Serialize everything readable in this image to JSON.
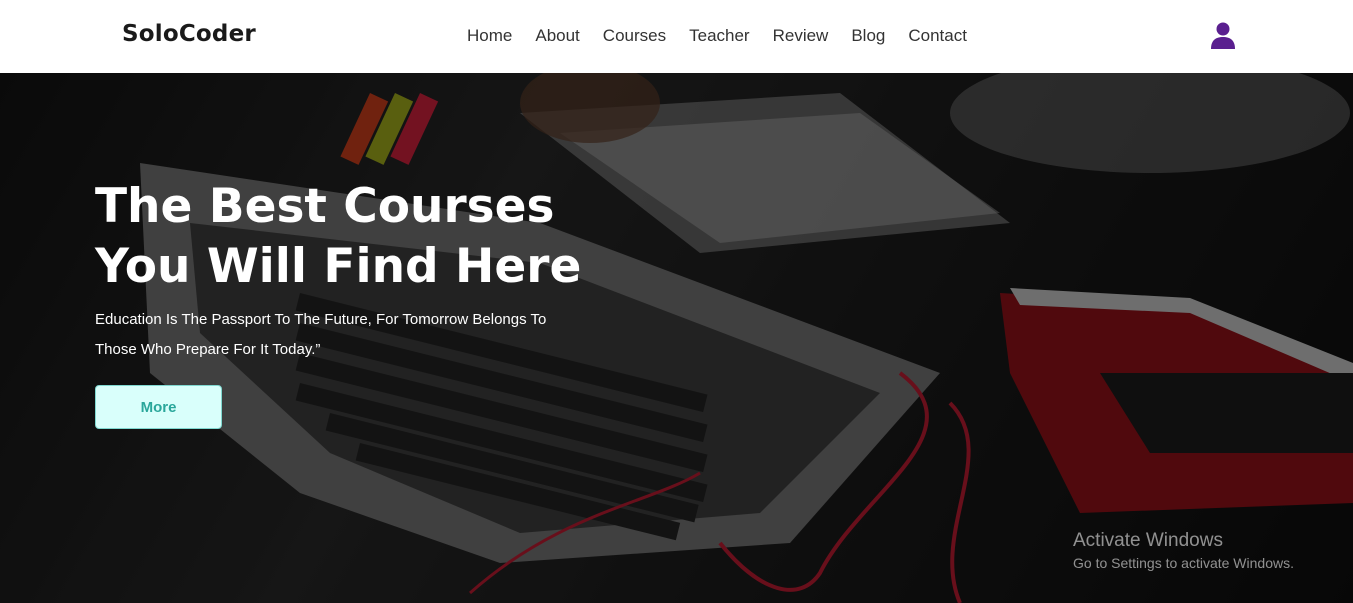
{
  "brand": {
    "logo": "SoloCoder"
  },
  "nav": {
    "items": [
      {
        "label": "Home"
      },
      {
        "label": "About"
      },
      {
        "label": "Courses"
      },
      {
        "label": "Teacher"
      },
      {
        "label": "Review"
      },
      {
        "label": "Blog"
      },
      {
        "label": "Contact"
      }
    ],
    "user_icon": "user-icon",
    "user_icon_color": "#5a1f8f"
  },
  "hero": {
    "title_line1": "The Best Courses",
    "title_line2": "You Will Find Here",
    "subtitle": "Education Is The Passport To The Future, For Tomorrow Belongs To Those Who Prepare For It Today.”",
    "button_label": "More",
    "button_bg": "#d9fffb",
    "button_text_color": "#2aa79b"
  },
  "watermark": {
    "title": "Activate Windows",
    "subtitle": "Go to Settings to activate Windows."
  }
}
